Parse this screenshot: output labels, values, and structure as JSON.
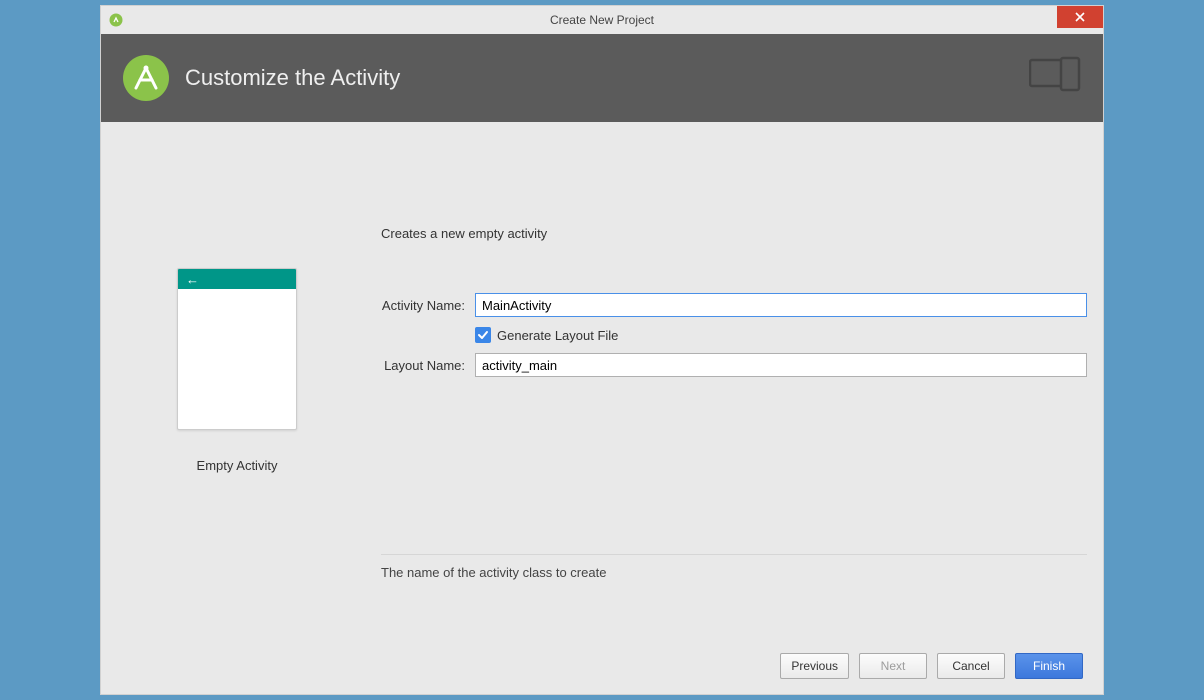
{
  "window": {
    "title": "Create New Project"
  },
  "header": {
    "heading": "Customize the Activity"
  },
  "preview": {
    "caption": "Empty Activity",
    "back_arrow": "←"
  },
  "form": {
    "description": "Creates a new empty activity",
    "activity_name_label": "Activity Name:",
    "activity_name_value": "MainActivity",
    "generate_layout_checked": true,
    "generate_layout_label": "Generate Layout File",
    "layout_name_label": "Layout Name:",
    "layout_name_value": "activity_main",
    "hint": "The name of the activity class to create"
  },
  "footer": {
    "previous": "Previous",
    "next": "Next",
    "cancel": "Cancel",
    "finish": "Finish"
  }
}
